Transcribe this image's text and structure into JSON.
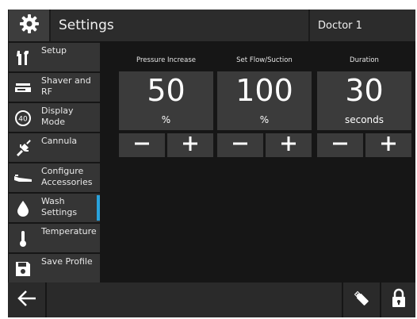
{
  "header": {
    "icon": "gear-icon",
    "title": "Settings",
    "user": "Doctor 1"
  },
  "sidebar": {
    "items": [
      {
        "label": "Setup",
        "icon": "tools-icon",
        "active": false
      },
      {
        "label": "Shaver and RF",
        "icon": "shaver-icon",
        "active": false
      },
      {
        "label": "Display Mode",
        "icon": "display-mode-icon",
        "active": false
      },
      {
        "label": "Cannula",
        "icon": "cannula-icon",
        "active": false
      },
      {
        "label": "Configure Accessories",
        "icon": "accessories-icon",
        "active": false
      },
      {
        "label": "Wash Settings",
        "icon": "droplet-icon",
        "active": true
      },
      {
        "label": "Temperature",
        "icon": "thermometer-icon",
        "active": false
      },
      {
        "label": "Save Profile",
        "icon": "save-icon",
        "active": false
      }
    ]
  },
  "display_mode_badge": "40",
  "main": {
    "panels": [
      {
        "label": "Pressure Increase",
        "value": "50",
        "unit": "%"
      },
      {
        "label": "Set Flow/Suction",
        "value": "100",
        "unit": "%"
      },
      {
        "label": "Duration",
        "value": "30",
        "unit": "seconds"
      }
    ],
    "minus_icon": "minus-icon",
    "plus_icon": "plus-icon"
  },
  "footer": {
    "back_icon": "back-arrow-icon",
    "usb_icon": "usb-icon",
    "lock_icon": "lock-icon"
  },
  "colors": {
    "accent": "#29a3dd",
    "background": "#161616",
    "button": "#3b3b3b",
    "sidebar_item": "#353535"
  }
}
